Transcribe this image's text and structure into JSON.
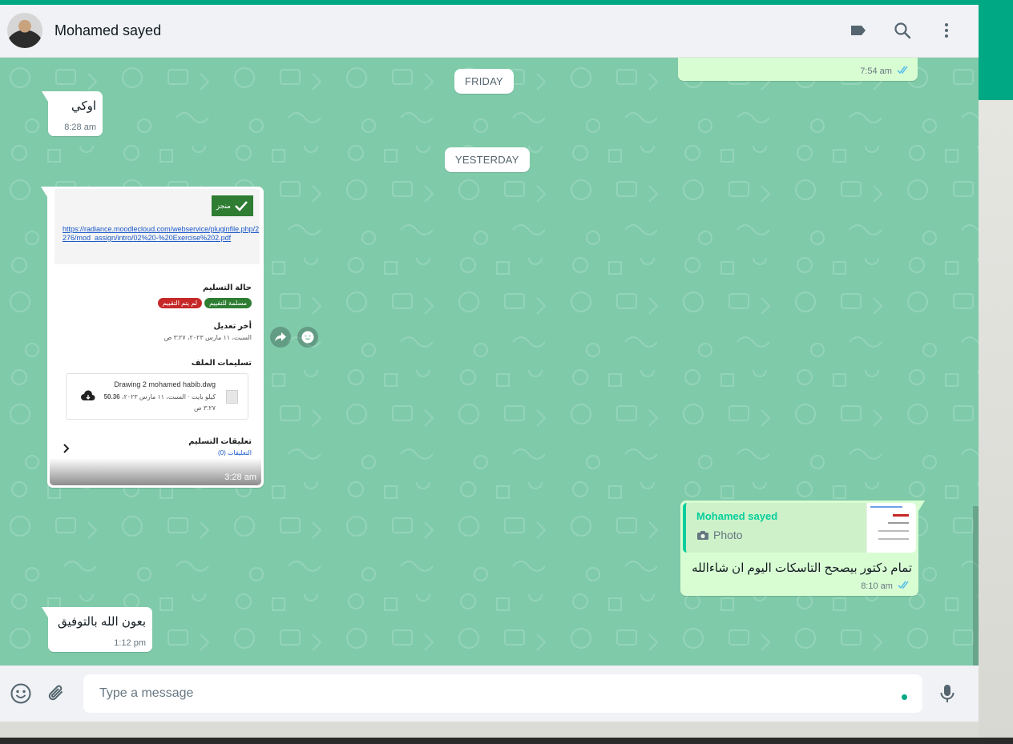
{
  "header": {
    "contact_name": "Mohamed sayed",
    "icons": [
      "label-icon",
      "search-icon",
      "menu-icon"
    ]
  },
  "colors": {
    "accent": "#00a884",
    "chat_background": "#7fcaa9",
    "incoming_bubble": "#ffffff",
    "outgoing_bubble": "#d9fdd3",
    "read_ticks": "#53bdeb"
  },
  "dates": {
    "friday": "FRIDAY",
    "yesterday": "YESTERDAY"
  },
  "messages": {
    "top_out_time": "7:54 am",
    "okay": {
      "text": "اوكي",
      "time": "8:28 am"
    },
    "image": {
      "time": "3:28 am",
      "badge": "منجز",
      "link": "https://radiance.moodlecloud.com/webservice/pluginfile.php/2276/mod_assign/intro/02%20-%20Exercise%202.pdf",
      "status_label": "حالة التسليم",
      "status_green": "مسلمة للتقييم",
      "status_red": "لم يتم التقييم",
      "modified_label": "أخر تعديل",
      "modified_value": "السبت، ١١ مارس ٢٠٢٣، ٣:٢٧ ص",
      "files_label": "تسليمات الملف",
      "file_name": "Drawing 2 mohamed habib.dwg",
      "file_size": "50.36",
      "file_meta": "كيلو بايت · السبت، ١١ مارس ٢٠٢٣،",
      "file_meta_time": "٣:٢٧ ص",
      "comments_label": "تعليقات التسليم",
      "comments_link": "التعليقات (0)"
    },
    "reply": {
      "quote_author": "Mohamed sayed",
      "quote_type": "Photo",
      "text": "تمام دكتور بيصحح التاسكات اليوم ان شاءالله",
      "time": "8:10 am"
    },
    "last": {
      "text": "بعون الله بالتوفيق",
      "time": "1:12 pm"
    }
  },
  "composer": {
    "placeholder": "Type a message",
    "icons": [
      "emoji-icon",
      "attach-icon",
      "mic-icon"
    ]
  }
}
